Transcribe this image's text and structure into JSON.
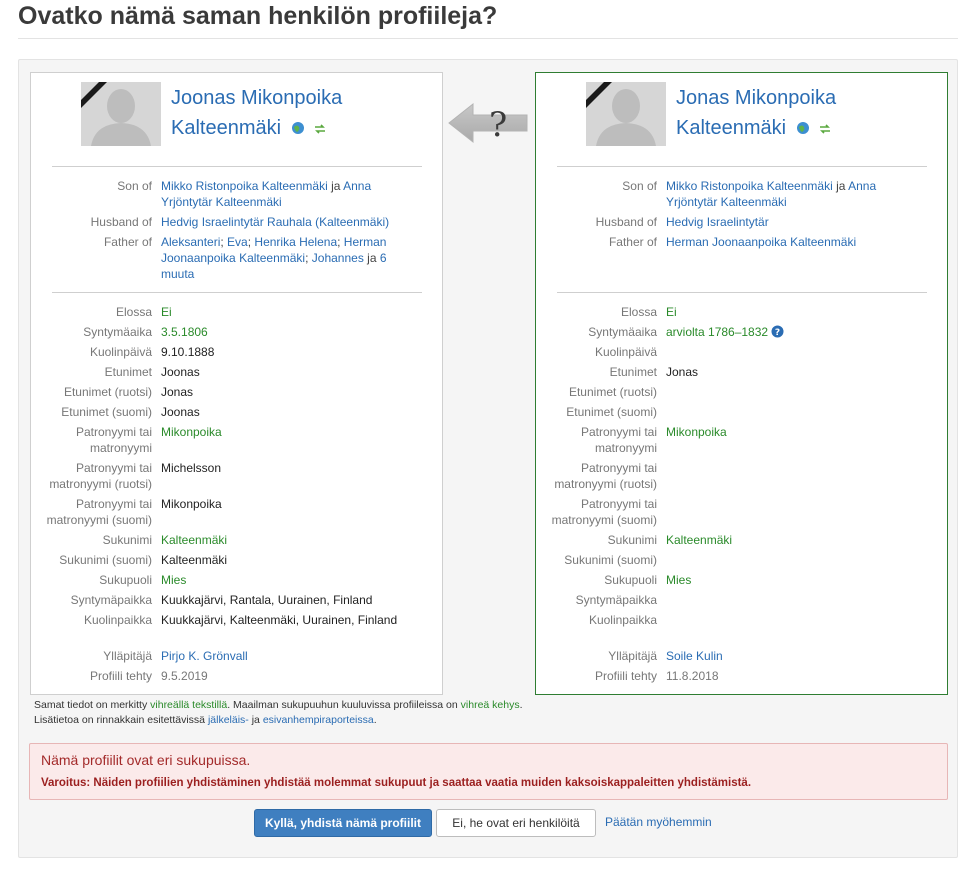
{
  "page": {
    "title": "Ovatko nämä saman henkilön profiileja?"
  },
  "labels": {
    "son_of": "Son of",
    "husband_of": "Husband of",
    "father_of": "Father of",
    "elossa": "Elossa",
    "syntymaaika": "Syntymäaika",
    "kuolinpaiva": "Kuolinpäivä",
    "etunimet": "Etunimet",
    "etunimet_ruotsi": "Etunimet (ruotsi)",
    "etunimet_suomi": "Etunimet (suomi)",
    "patronyymi_1": "Patronyymi tai",
    "patronyymi_2": "matronyymi",
    "patronyymi_ruotsi_2": "matronyymi (ruotsi)",
    "patronyymi_suomi_2": "matronyymi (suomi)",
    "sukunimi": "Sukunimi",
    "sukunimi_suomi": "Sukunimi (suomi)",
    "sukupuoli": "Sukupuoli",
    "syntymapaikka": "Syntymäpaikka",
    "kuolinpaikka": "Kuolinpaikka",
    "yllapitaja": "Ylläpitäjä",
    "profiili_tehty": "Profiili tehty"
  },
  "left": {
    "name_line1": "Joonas Mikonpoika",
    "name_line2": "Kalteenmäki",
    "son_of_1": "Mikko Ristonpoika Kalteenmäki",
    "son_of_and": " ja ",
    "son_of_2": "Anna Yrjöntytär Kalteenmäki",
    "husband_of": "Hedvig Israelintytär Rauhala (Kalteenmäki)",
    "father_of_1": "Aleksanteri",
    "father_of_2": "Eva",
    "father_of_3": "Henrika Helena",
    "father_of_4": "Herman Joonaanpoika Kalteenmäki",
    "father_of_5": "Johannes",
    "father_of_ja": " ja ",
    "father_of_more": "6 muuta",
    "sep": "; ",
    "elossa": "Ei",
    "syntymaaika": "3.5.1806",
    "kuolinpaiva": "9.10.1888",
    "etunimet": "Joonas",
    "etunimet_ruotsi": "Jonas",
    "etunimet_suomi": "Joonas",
    "patronyymi": "Mikonpoika",
    "patronyymi_ruotsi": "Michelsson",
    "patronyymi_suomi": "Mikonpoika",
    "sukunimi": "Kalteenmäki",
    "sukunimi_suomi": "Kalteenmäki",
    "sukupuoli": "Mies",
    "syntymapaikka": "Kuukkajärvi, Rantala, Uurainen, Finland",
    "kuolinpaikka": "Kuukkajärvi, Kalteenmäki, Uurainen, Finland",
    "yllapitaja": "Pirjo K. Grönvall",
    "profiili_tehty": "9.5.2019"
  },
  "right": {
    "name_line1": "Jonas Mikonpoika",
    "name_line2": "Kalteenmäki",
    "son_of_1": "Mikko Ristonpoika Kalteenmäki",
    "son_of_and": " ja ",
    "son_of_2": "Anna Yrjöntytär Kalteenmäki",
    "husband_of": "Hedvig Israelintytär",
    "father_of": "Herman Joonaanpoika Kalteenmäki",
    "elossa": "Ei",
    "syntymaaika": "arviolta 1786–1832",
    "etunimet": "Jonas",
    "patronyymi": "Mikonpoika",
    "sukunimi": "Kalteenmäki",
    "sukupuoli": "Mies",
    "yllapitaja": "Soile Kulin",
    "profiili_tehty": "11.8.2018"
  },
  "arrow": {
    "glyph": "?"
  },
  "help": {
    "glyph": "?"
  },
  "footnote": {
    "line1_a": "Samat tiedot on merkitty ",
    "line1_green": "vihreällä tekstillä",
    "line1_b": ". Maailman sukupuuhun kuuluvissa profiileissa on ",
    "line1_frame": "vihreä kehys",
    "line1_c": ".",
    "line2_a": "Lisätietoa on rinnakkain esitettävissä ",
    "line2_link1": "jälkeläis-",
    "line2_b": " ja ",
    "line2_link2": "esivanhempiraporteissa",
    "line2_c": "."
  },
  "alert": {
    "title": "Nämä profiilit ovat eri sukupuissa.",
    "text": "Varoitus: Näiden profiilien yhdistäminen yhdistää molemmat sukupuut ja saattaa vaatia muiden kaksoiskappaleitten yhdistämistä."
  },
  "actions": {
    "merge": "Kyllä, yhdistä nämä profiilit",
    "different": "Ei, he ovat eri henkilöitä",
    "later": "Päätän myöhemmin"
  },
  "colors": {
    "link": "#2a6cb3",
    "match_green": "#2a8a2a",
    "world_tree_frame": "#2f7d32",
    "alert_bg": "#fbeaea",
    "primary_button": "#3f7fc0"
  }
}
